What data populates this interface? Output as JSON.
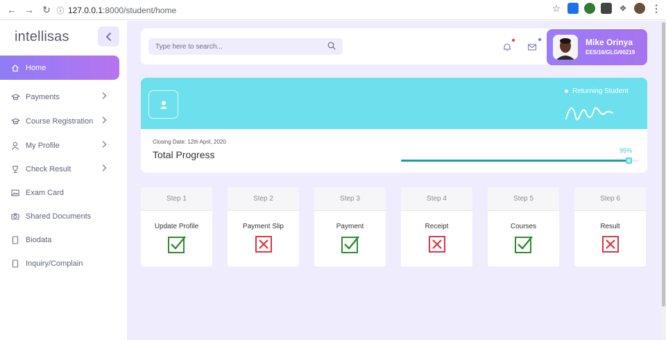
{
  "browser": {
    "url_host": "127.0.0.1",
    "url_rest": ":8000/student/home"
  },
  "sidebar": {
    "brand": "intellisas",
    "items": [
      {
        "label": "Home",
        "icon": "home-icon",
        "active": true,
        "chevron": false
      },
      {
        "label": "Payments",
        "icon": "mortarboard-icon",
        "chevron": true
      },
      {
        "label": "Course Registration",
        "icon": "mortarboard-icon",
        "chevron": true
      },
      {
        "label": "My Profile",
        "icon": "user-icon",
        "chevron": true
      },
      {
        "label": "Check Result",
        "icon": "trophy-icon",
        "chevron": true
      },
      {
        "label": "Exam Card",
        "icon": "image-icon",
        "chevron": false
      },
      {
        "label": "Shared Documents",
        "icon": "camera-icon",
        "chevron": false
      },
      {
        "label": "Biodata",
        "icon": "document-icon",
        "chevron": false
      },
      {
        "label": "Inquiry/Complain",
        "icon": "document-icon",
        "chevron": false
      }
    ]
  },
  "header": {
    "search_placeholder": "Type here to search...",
    "profile": {
      "name": "Mike Orinya",
      "reg_no": "EES/16/GLG/00219"
    }
  },
  "hero": {
    "status": "Returning Student",
    "closing_date": "Closing Date: 12th April, 2020",
    "progress_title": "Total Progress",
    "progress_label": "95%",
    "progress_value": 0.95
  },
  "steps": [
    {
      "step": "Step 1",
      "title": "Update Profile",
      "done": true
    },
    {
      "step": "Step 2",
      "title": "Payment Slip",
      "done": false
    },
    {
      "step": "Step 3",
      "title": "Payment",
      "done": true
    },
    {
      "step": "Step 4",
      "title": "Receipt",
      "done": false
    },
    {
      "step": "Step 5",
      "title": "Courses",
      "done": true
    },
    {
      "step": "Step 6",
      "title": "Result",
      "done": false
    }
  ],
  "colors": {
    "accent": "#9a7cf6",
    "hero_band": "#6ce0ec",
    "progress": "#179ea6",
    "done": "#2e8b2e",
    "not_done": "#d9343f"
  }
}
